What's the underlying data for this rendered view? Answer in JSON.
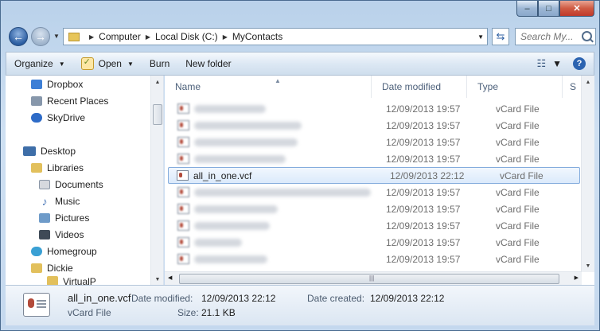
{
  "window": {
    "minimize": "–",
    "maximize": "□",
    "close": "✕"
  },
  "address": {
    "crumbs": [
      "Computer",
      "Local Disk (C:)",
      "MyContacts"
    ],
    "search_placeholder": "Search My..."
  },
  "toolbar": {
    "organize": "Organize",
    "open": "Open",
    "burn": "Burn",
    "new_folder": "New folder"
  },
  "nav": {
    "items": [
      {
        "label": "Dropbox",
        "icon": "dropbox-icon",
        "color": "#3d7fd6"
      },
      {
        "label": "Recent Places",
        "icon": "recent-places-icon",
        "color": "#8797ab"
      },
      {
        "label": "SkyDrive",
        "icon": "skydrive-icon",
        "color": "#2e6bc7"
      },
      {
        "label": "Desktop",
        "icon": "desktop-icon",
        "color": "#3e6ea8"
      },
      {
        "label": "Libraries",
        "icon": "libraries-icon",
        "color": "#e2c05c"
      },
      {
        "label": "Documents",
        "icon": "documents-icon",
        "color": "#d6d9de"
      },
      {
        "label": "Music",
        "icon": "music-icon",
        "color": "#4d79b8"
      },
      {
        "label": "Pictures",
        "icon": "pictures-icon",
        "color": "#6e9bc9"
      },
      {
        "label": "Videos",
        "icon": "videos-icon",
        "color": "#3f4a57"
      },
      {
        "label": "Homegroup",
        "icon": "homegroup-icon",
        "color": "#3aa0d4"
      },
      {
        "label": "Dickie",
        "icon": "user-folder-icon",
        "color": "#e2c05c"
      },
      {
        "label": "VirtualP",
        "icon": "folder-icon",
        "color": "#e2c05c"
      }
    ]
  },
  "columns": {
    "name": "Name",
    "date": "Date modified",
    "type": "Type",
    "size": "S"
  },
  "files": [
    {
      "name": "",
      "blurred": true,
      "blur_width": 90,
      "date": "12/09/2013 19:57",
      "type": "vCard File"
    },
    {
      "name": "",
      "blurred": true,
      "blur_width": 135,
      "date": "12/09/2013 19:57",
      "type": "vCard File"
    },
    {
      "name": "",
      "blurred": true,
      "blur_width": 130,
      "date": "12/09/2013 19:57",
      "type": "vCard File"
    },
    {
      "name": "",
      "blurred": true,
      "blur_width": 115,
      "date": "12/09/2013 19:57",
      "type": "vCard File"
    },
    {
      "name": "all_in_one.vcf",
      "blurred": false,
      "selected": true,
      "date": "12/09/2013 22:12",
      "type": "vCard File"
    },
    {
      "name": "",
      "blurred": true,
      "blur_width": 222,
      "date": "12/09/2013 19:57",
      "type": "vCard File"
    },
    {
      "name": "",
      "blurred": true,
      "blur_width": 105,
      "date": "12/09/2013 19:57",
      "type": "vCard File"
    },
    {
      "name": "",
      "blurred": true,
      "blur_width": 95,
      "date": "12/09/2013 19:57",
      "type": "vCard File"
    },
    {
      "name": "",
      "blurred": true,
      "blur_width": 60,
      "date": "12/09/2013 19:57",
      "type": "vCard File"
    },
    {
      "name": "",
      "blurred": true,
      "blur_width": 92,
      "date": "12/09/2013 19:57",
      "type": "vCard File"
    }
  ],
  "details": {
    "name": "all_in_one.vcf",
    "type": "vCard File",
    "date_modified_label": "Date modified:",
    "date_modified": "12/09/2013 22:12",
    "date_created_label": "Date created:",
    "date_created": "12/09/2013 22:12",
    "size_label": "Size:",
    "size": "21.1 KB"
  }
}
